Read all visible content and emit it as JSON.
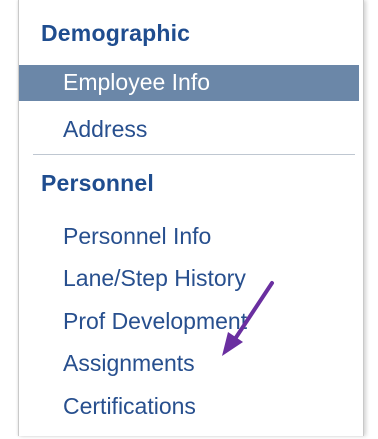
{
  "sections": [
    {
      "header": "Demographic",
      "items": [
        {
          "label": "Employee Info",
          "selected": true
        },
        {
          "label": "Address",
          "selected": false
        }
      ]
    },
    {
      "header": "Personnel",
      "items": [
        {
          "label": "Personnel Info",
          "selected": false
        },
        {
          "label": "Lane/Step History",
          "selected": false
        },
        {
          "label": "Prof Development",
          "selected": false
        },
        {
          "label": "Assignments",
          "selected": false
        },
        {
          "label": "Certifications",
          "selected": false
        }
      ]
    }
  ],
  "colors": {
    "header_text": "#1f4d8f",
    "link_text": "#274f8e",
    "selected_bg": "#6b87a8",
    "arrow": "#6a2fa0"
  }
}
